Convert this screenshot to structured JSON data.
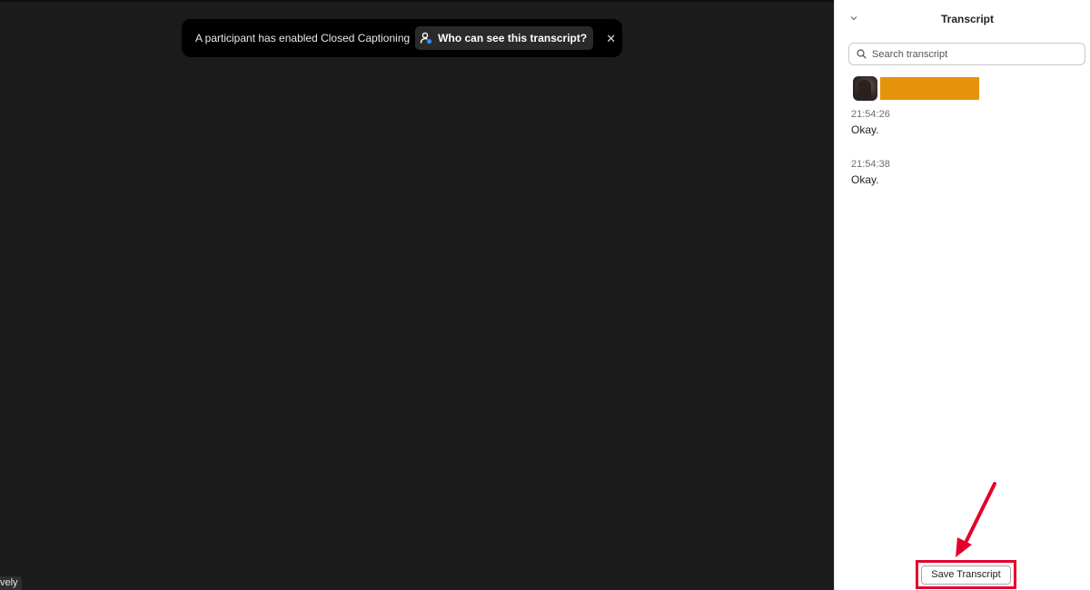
{
  "notice": {
    "text": "A participant has enabled Closed Captioning",
    "who_button": "Who can see this transcript?",
    "close_icon": "close-icon"
  },
  "video": {
    "name_tag": "vely"
  },
  "transcript_panel": {
    "title": "Transcript",
    "collapse_icon": "chevron-down-icon",
    "search_placeholder": "Search transcript",
    "entries": [
      {
        "time": "21:54:26",
        "text": "Okay."
      },
      {
        "time": "21:54:38",
        "text": "Okay."
      }
    ],
    "save_button": "Save Transcript"
  },
  "colors": {
    "video_bg": "#1b1b1b",
    "notice_bg": "#000000",
    "redaction": "#e5930a",
    "highlight": "#e4002b",
    "who_icon_accent": "#2d8cff"
  }
}
